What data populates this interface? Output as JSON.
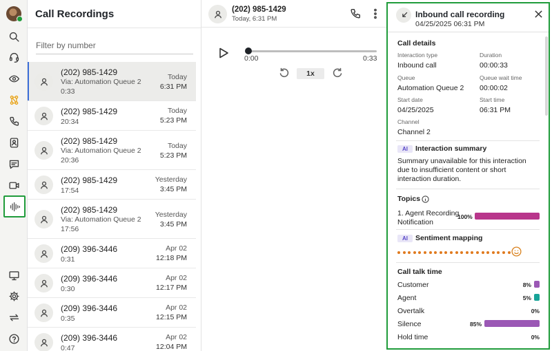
{
  "list": {
    "title": "Call Recordings",
    "filter_placeholder": "Filter by number",
    "items": [
      {
        "number": "(202) 985-1429",
        "queue": "Via: Automation Queue 2",
        "duration": "0:33",
        "day": "Today",
        "time": "6:31 PM",
        "selected": true
      },
      {
        "number": "(202) 985-1429",
        "queue": "",
        "duration": "20:34",
        "day": "Today",
        "time": "5:23 PM"
      },
      {
        "number": "(202) 985-1429",
        "queue": "Via: Automation Queue 2",
        "duration": "20:36",
        "day": "Today",
        "time": "5:23 PM"
      },
      {
        "number": "(202) 985-1429",
        "queue": "",
        "duration": "17:54",
        "day": "Yesterday",
        "time": "3:45 PM"
      },
      {
        "number": "(202) 985-1429",
        "queue": "Via: Automation Queue 2",
        "duration": "17:56",
        "day": "Yesterday",
        "time": "3:45 PM"
      },
      {
        "number": "(209) 396-3446",
        "queue": "",
        "duration": "0:31",
        "day": "Apr 02",
        "time": "12:18 PM"
      },
      {
        "number": "(209) 396-3446",
        "queue": "",
        "duration": "0:30",
        "day": "Apr 02",
        "time": "12:17 PM"
      },
      {
        "number": "(209) 396-3446",
        "queue": "",
        "duration": "0:35",
        "day": "Apr 02",
        "time": "12:15 PM"
      },
      {
        "number": "(209) 396-3446",
        "queue": "",
        "duration": "0:47",
        "day": "Apr 02",
        "time": "12:04 PM"
      }
    ]
  },
  "player": {
    "number": "(202) 985-1429",
    "date": "Today, 6:31 PM",
    "position": "0:00",
    "length": "0:33",
    "speed": "1x",
    "progress": 0
  },
  "details": {
    "title": "Inbound call recording",
    "datetime": "04/25/2025 06:31 PM",
    "call_details": {
      "title": "Call details",
      "interaction_type_label": "Interaction type",
      "interaction_type": "Inbound call",
      "duration_label": "Duration",
      "duration": "00:00:33",
      "queue_label": "Queue",
      "queue": "Automation Queue 2",
      "queue_wait_label": "Queue wait time",
      "queue_wait": "00:00:02",
      "start_date_label": "Start date",
      "start_date": "04/25/2025",
      "start_time_label": "Start time",
      "start_time": "06:31 PM",
      "channel_label": "Channel",
      "channel": "Channel 2"
    },
    "ai_badge": "AI",
    "summary": {
      "title": "Interaction summary",
      "text": "Summary unavailable for this interaction due to insufficient content or short interaction duration."
    },
    "topics": {
      "title": "Topics",
      "items": [
        {
          "label": "1. Agent Recording Notification",
          "percent_label": "100%",
          "percent": 100,
          "color": "#b8368b"
        }
      ]
    },
    "sentiment": {
      "title": "Sentiment mapping",
      "color": "#e07a1f"
    },
    "talk_time": {
      "title": "Call talk time",
      "rows": [
        {
          "label": "Customer",
          "percent_label": "8%",
          "percent": 8,
          "color": "#9b58b5"
        },
        {
          "label": "Agent",
          "percent_label": "5%",
          "percent": 5,
          "color": "#17a398"
        },
        {
          "label": "Overtalk",
          "percent_label": "0%",
          "percent": 0,
          "color": "#9b58b5"
        },
        {
          "label": "Silence",
          "percent_label": "85%",
          "percent": 85,
          "color": "#9b58b5"
        },
        {
          "label": "Hold time",
          "percent_label": "0%",
          "percent": 0,
          "color": "#9b58b5"
        }
      ]
    }
  },
  "colors": {
    "accent_highlight": "#1f9b3a",
    "selection_marker": "#3d6fd9"
  }
}
